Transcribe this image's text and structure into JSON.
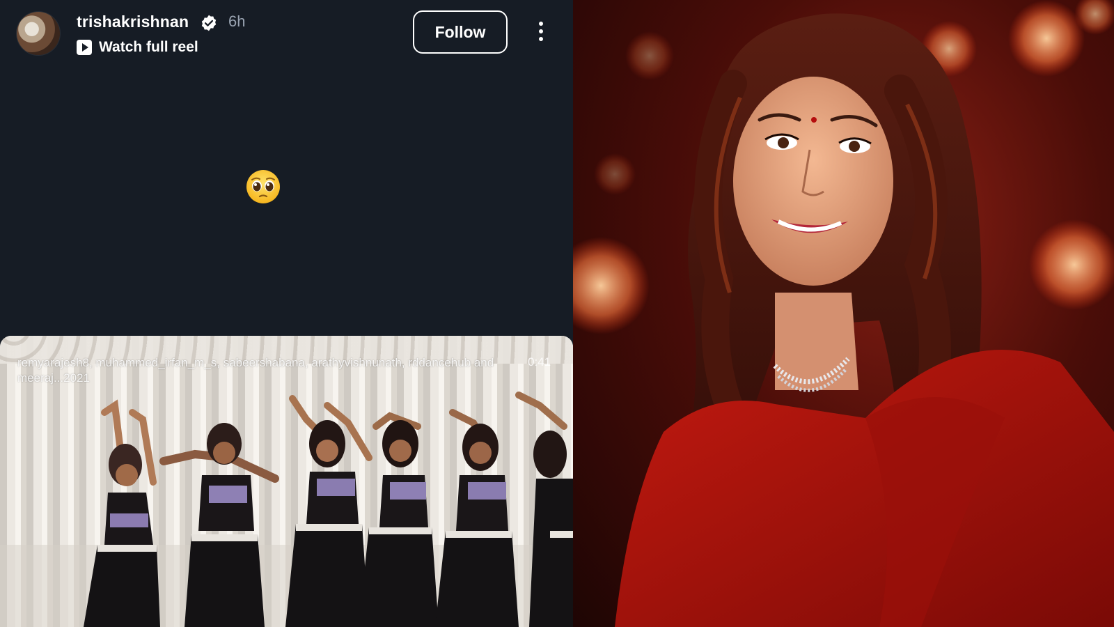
{
  "story": {
    "username": "trishakrishnan",
    "time_ago": "6h",
    "reel_link_label": "Watch full reel",
    "follow_label": "Follow",
    "icons": {
      "verified": "verified-badge-icon",
      "reel": "play-icon",
      "more": "more-vertical-icon",
      "emoji": "pleading-face-emoji"
    },
    "reel_preview": {
      "tags": "remyarajesh8, muhammed_irfan_m_s, sabeershabana, arathyvishnunath, rddancehub and meeraj...2021",
      "duration": "0:41"
    }
  },
  "colors": {
    "story_background": "#161c25",
    "verified_blue": "#ffffff",
    "photo_red": "#b3160f"
  }
}
